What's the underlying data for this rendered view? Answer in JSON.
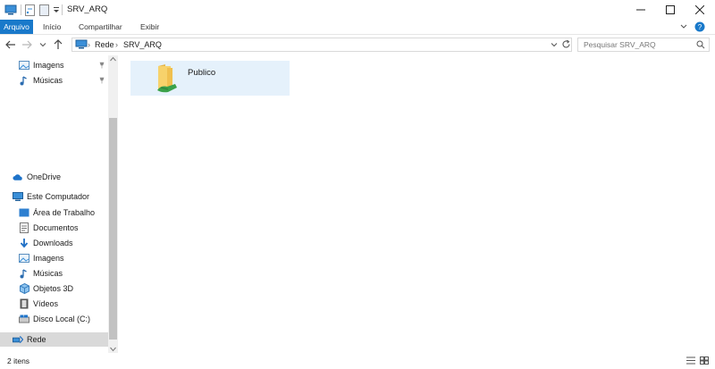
{
  "window": {
    "title": "SRV_ARQ"
  },
  "ribbon": {
    "tabs": [
      "Arquivo",
      "Início",
      "Compartilhar",
      "Exibir"
    ]
  },
  "address": {
    "crumbs": [
      "Rede",
      "SRV_ARQ"
    ]
  },
  "search": {
    "placeholder": "Pesquisar SRV_ARQ"
  },
  "sidebar": {
    "pinned": [
      "Imagens",
      "Músicas"
    ],
    "onedrive": "OneDrive",
    "computer": "Este Computador",
    "computer_items": [
      "Área de Trabalho",
      "Documentos",
      "Downloads",
      "Imagens",
      "Músicas",
      "Objetos 3D",
      "Vídeos",
      "Disco Local (C:)"
    ],
    "network": "Rede"
  },
  "content": {
    "items": [
      {
        "name": "Publico"
      }
    ]
  },
  "status": {
    "count": "2 itens"
  },
  "colors": {
    "accent": "#1979ca",
    "selection": "#e5f1fb"
  }
}
